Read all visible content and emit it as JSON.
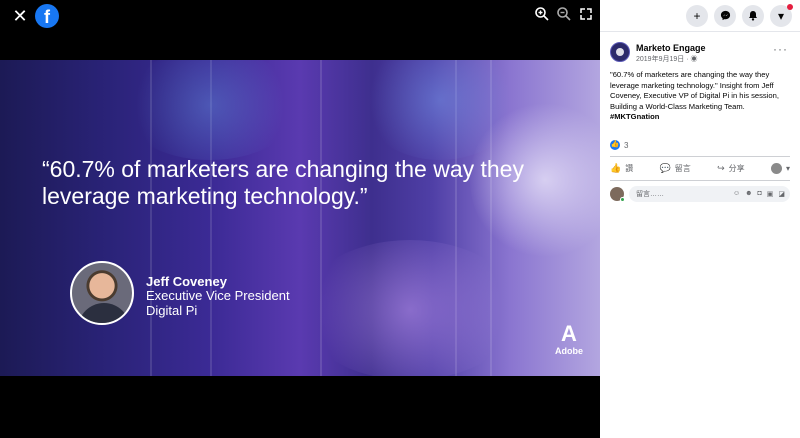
{
  "viewer": {
    "close_icon": "close-icon",
    "logo_icon": "facebook-logo-icon",
    "zoom_tools": [
      "zoom-in-icon",
      "zoom-out-icon",
      "fullscreen-icon"
    ]
  },
  "photo": {
    "quote": "“60.7% of marketers are changing the way they leverage marketing technology.”",
    "person_name": "Jeff Coveney",
    "person_title": "Executive Vice President",
    "person_company": "Digital Pi",
    "brand_mark": "A",
    "brand_word": "Adobe"
  },
  "panel": {
    "top_buttons": [
      "plus-icon",
      "messenger-icon",
      "notifications-icon",
      "dropdown-icon"
    ],
    "page_name": "Marketo Engage",
    "post_date": "2019年9月19日 · ",
    "more": "···",
    "body_text": "\"60.7% of marketers are changing the way they leverage marketing technology.\" Insight from Jeff Coveney, Executive VP of Digital Pi in his session, Building a World-Class Marketing Team. ",
    "hashtag": "#MKTGnation",
    "like_count": "3",
    "actions": {
      "like": "讚",
      "comment": "留言",
      "share": "分享"
    },
    "comment_placeholder": "留言……"
  },
  "colors": {
    "accent": "#1877f2",
    "photo_bg": "#2a2378",
    "online": "#31a24c"
  }
}
